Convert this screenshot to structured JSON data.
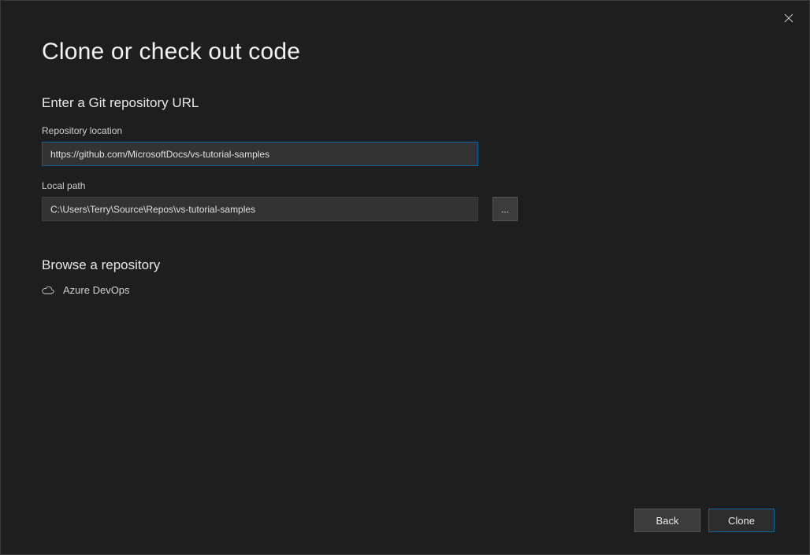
{
  "dialog": {
    "title": "Clone or check out code",
    "section_heading": "Enter a Git repository URL"
  },
  "repo_location": {
    "label": "Repository location",
    "value": "https://github.com/MicrosoftDocs/vs-tutorial-samples"
  },
  "local_path": {
    "label": "Local path",
    "value": "C:\\Users\\Terry\\Source\\Repos\\vs-tutorial-samples",
    "browse_label": "..."
  },
  "browse": {
    "heading": "Browse a repository",
    "providers": [
      {
        "label": "Azure DevOps",
        "icon": "cloud"
      }
    ]
  },
  "footer": {
    "back_label": "Back",
    "clone_label": "Clone"
  }
}
